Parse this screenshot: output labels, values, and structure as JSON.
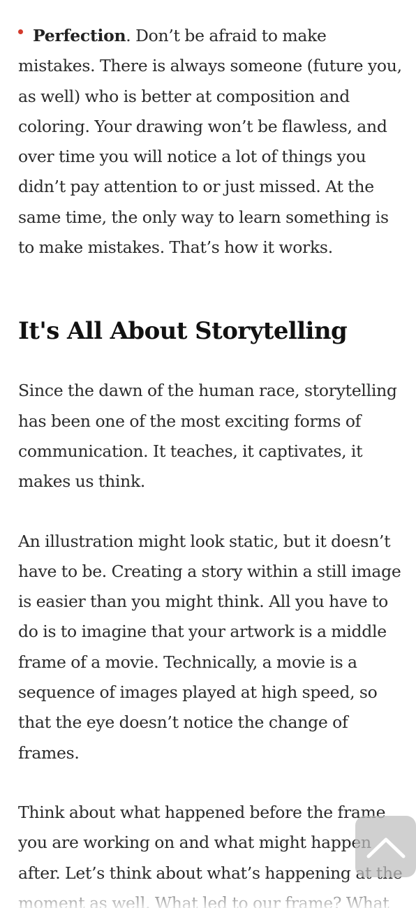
{
  "list_item": {
    "strong": "Perfection",
    "text": ". Don’t be afraid to make mistakes. There is always someone (future you, as well) who is better at composition and coloring. Your drawing won’t be flawless, and over time you will notice a lot of things you didn’t pay attention to or just missed. At the same time, the only way to learn something is to make mistakes. That’s how it works."
  },
  "section": {
    "heading": "It's All About Storytelling",
    "paragraphs": [
      "Since the dawn of the human race, storytelling has been one of the most exciting forms of communication. It teaches, it captivates, it makes us think.",
      "An illustration might look static, but it doesn’t have to be. Creating a story within a still image is easier than you might think. All you have to do is to imagine that your artwork is a middle frame of a movie. Technically, a movie is a sequence of images played at high speed, so that the eye doesn’t notice the change of frames.",
      "Think about what happened before the frame you are working on and what might happen after. Let’s think about what’s happening at the moment as well. What led to our frame? What"
    ]
  },
  "colors": {
    "bullet": "#d33a2c",
    "text": "#2b2b2b",
    "heading": "#111111"
  },
  "icons": {
    "back_to_top": "chevron-up-icon"
  }
}
